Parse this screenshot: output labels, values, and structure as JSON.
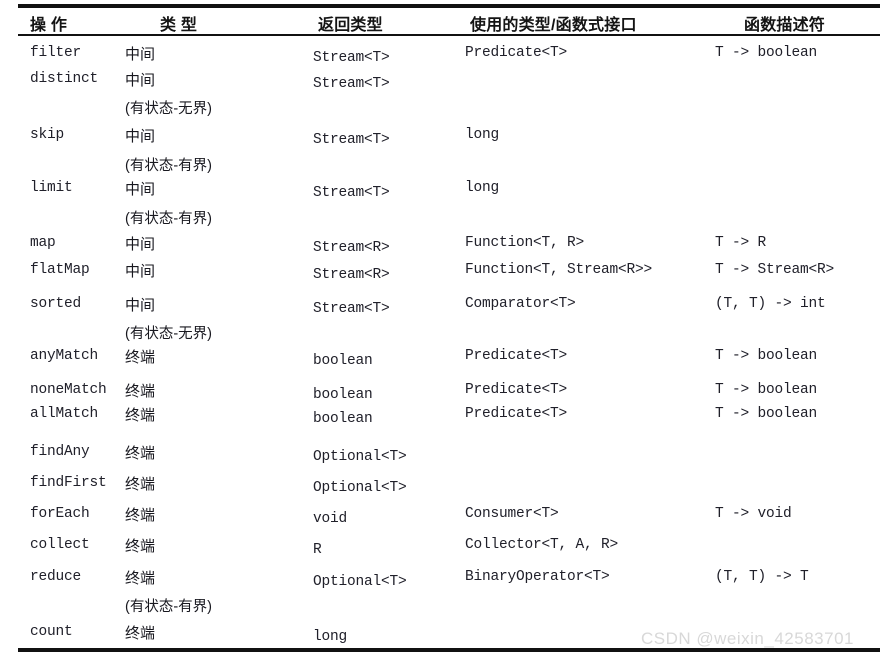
{
  "table": {
    "headers": [
      {
        "label": "操  作",
        "name": "header-operation"
      },
      {
        "label": "类  型",
        "name": "header-type"
      },
      {
        "label": "返回类型",
        "name": "header-return-type"
      },
      {
        "label": "使用的类型/函数式接口",
        "name": "header-functional-interface"
      },
      {
        "label": "函数描述符",
        "name": "header-function-descriptor"
      }
    ],
    "rows": [
      {
        "operation": "filter",
        "type": "中间",
        "type_note": "",
        "return_type": "Stream<T>",
        "functional_interface": "Predicate<T>",
        "function_descriptor": "T -> boolean"
      },
      {
        "operation": "distinct",
        "type": "中间",
        "type_note": "(有状态-无界)",
        "return_type": "Stream<T>",
        "functional_interface": "",
        "function_descriptor": ""
      },
      {
        "operation": "skip",
        "type": "中间",
        "type_note": "(有状态-有界)",
        "return_type": "Stream<T>",
        "functional_interface": "long",
        "function_descriptor": ""
      },
      {
        "operation": "limit",
        "type": "中间",
        "type_note": "(有状态-有界)",
        "return_type": "Stream<T>",
        "functional_interface": "long",
        "function_descriptor": ""
      },
      {
        "operation": "map",
        "type": "中间",
        "type_note": "",
        "return_type": "Stream<R>",
        "functional_interface": "Function<T, R>",
        "function_descriptor": "T -> R"
      },
      {
        "operation": "flatMap",
        "type": "中间",
        "type_note": "",
        "return_type": "Stream<R>",
        "functional_interface": "Function<T, Stream<R>>",
        "function_descriptor": "T -> Stream<R>"
      },
      {
        "operation": "sorted",
        "type": "中间",
        "type_note": "(有状态-无界)",
        "return_type": "Stream<T>",
        "functional_interface": "Comparator<T>",
        "function_descriptor": "(T, T) -> int"
      },
      {
        "operation": "anyMatch",
        "type": "终端",
        "type_note": "",
        "return_type": "boolean",
        "functional_interface": "Predicate<T>",
        "function_descriptor": "T -> boolean"
      },
      {
        "operation": "noneMatch",
        "type": "终端",
        "type_note": "",
        "return_type": "boolean",
        "functional_interface": "Predicate<T>",
        "function_descriptor": "T -> boolean"
      },
      {
        "operation": "allMatch",
        "type": "终端",
        "type_note": "",
        "return_type": "boolean",
        "functional_interface": "Predicate<T>",
        "function_descriptor": "T -> boolean"
      },
      {
        "operation": "findAny",
        "type": "终端",
        "type_note": "",
        "return_type": "Optional<T>",
        "functional_interface": "",
        "function_descriptor": ""
      },
      {
        "operation": "findFirst",
        "type": "终端",
        "type_note": "",
        "return_type": "Optional<T>",
        "functional_interface": "",
        "function_descriptor": ""
      },
      {
        "operation": "forEach",
        "type": "终端",
        "type_note": "",
        "return_type": "void",
        "functional_interface": "Consumer<T>",
        "function_descriptor": "T -> void"
      },
      {
        "operation": "collect",
        "type": "终端",
        "type_note": "",
        "return_type": "R",
        "functional_interface": "Collector<T, A, R>",
        "function_descriptor": ""
      },
      {
        "operation": "reduce",
        "type": "终端",
        "type_note": "(有状态-有界)",
        "return_type": "Optional<T>",
        "functional_interface": "BinaryOperator<T>",
        "function_descriptor": "(T, T) -> T"
      },
      {
        "operation": "count",
        "type": "终端",
        "type_note": "",
        "return_type": "long",
        "functional_interface": "",
        "function_descriptor": ""
      }
    ]
  },
  "watermark": {
    "text": "CSDN @weixin_42583701"
  },
  "colors": {
    "rule": "#111111",
    "text": "#20202a",
    "watermark": "#d8d8d8",
    "background": "#ffffff"
  }
}
